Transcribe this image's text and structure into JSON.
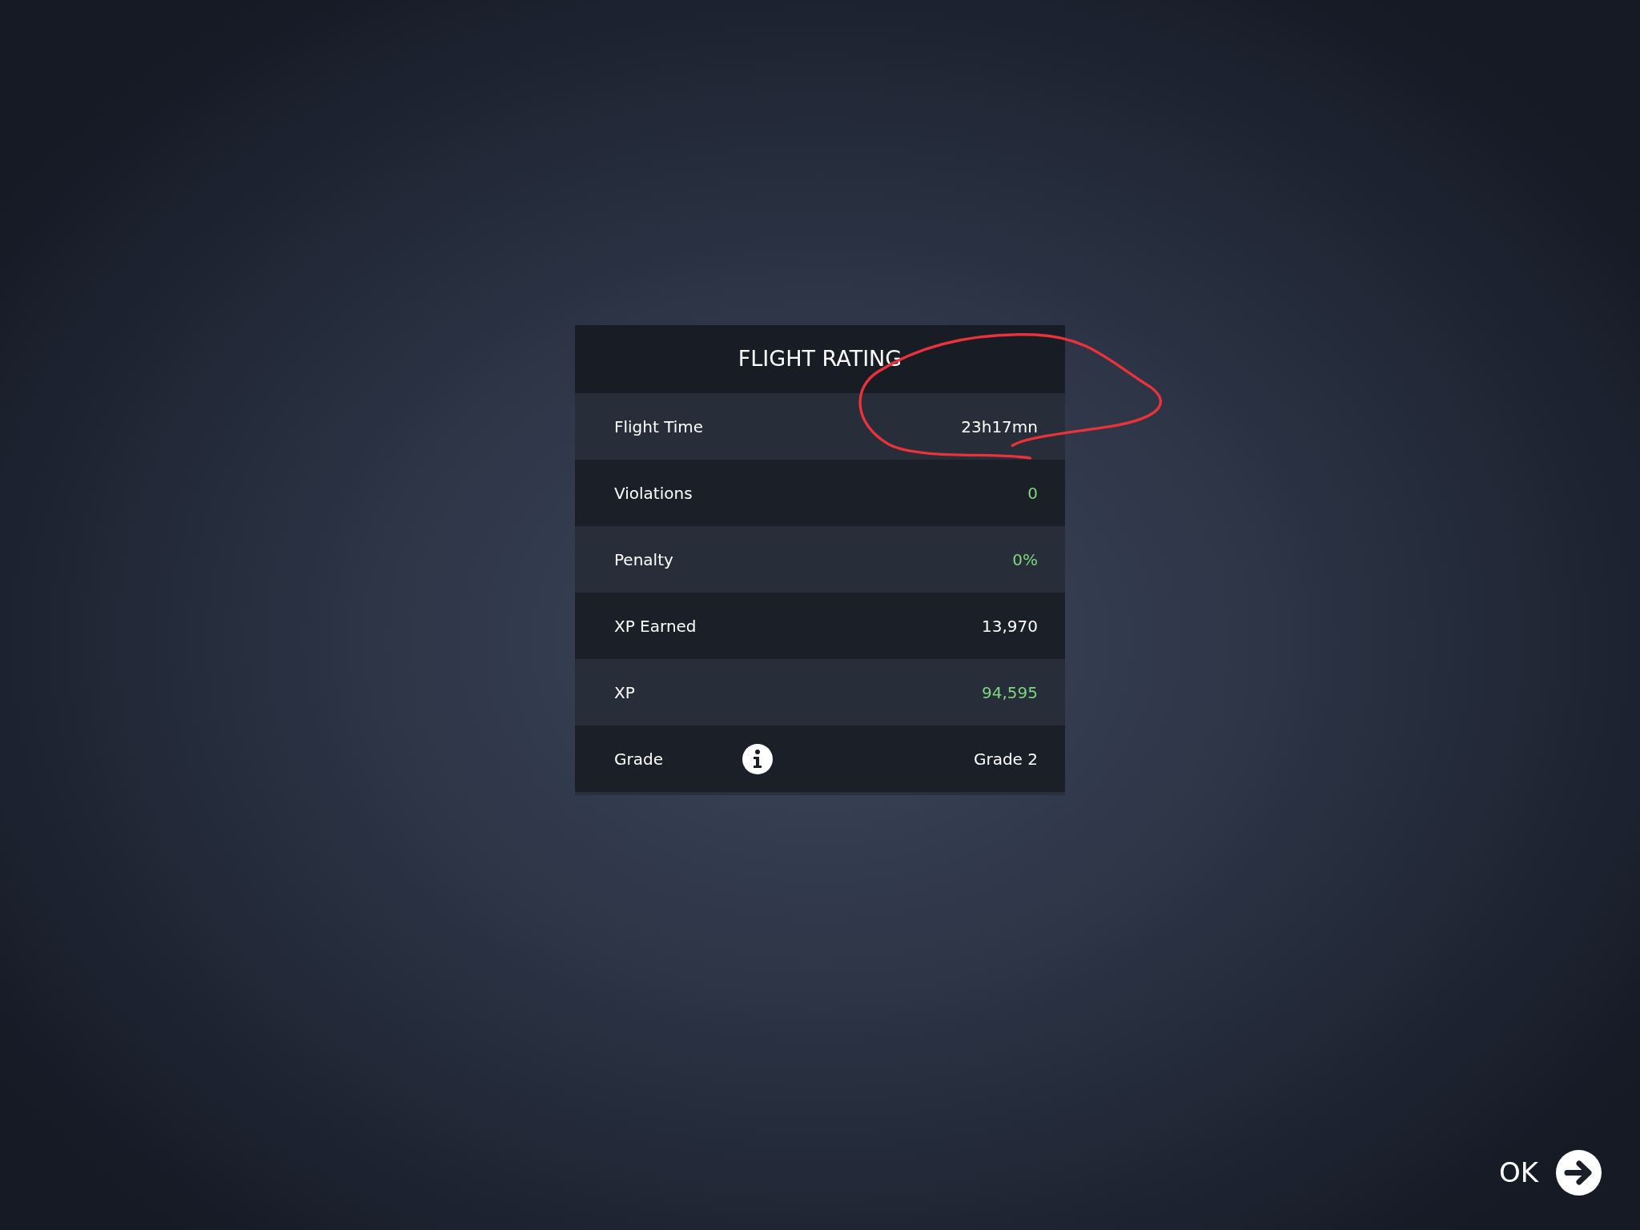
{
  "panel": {
    "title": "FLIGHT RATING",
    "rows": [
      {
        "label": "Flight Time",
        "value": "23h17mn",
        "positive": false,
        "info": false
      },
      {
        "label": "Violations",
        "value": "0",
        "positive": true,
        "info": false
      },
      {
        "label": "Penalty",
        "value": "0%",
        "positive": true,
        "info": false
      },
      {
        "label": "XP Earned",
        "value": "13,970",
        "positive": false,
        "info": false
      },
      {
        "label": "XP",
        "value": "94,595",
        "positive": true,
        "info": false
      },
      {
        "label": "Grade",
        "value": "Grade 2",
        "positive": false,
        "info": true
      }
    ]
  },
  "ok_button": {
    "label": "OK"
  }
}
